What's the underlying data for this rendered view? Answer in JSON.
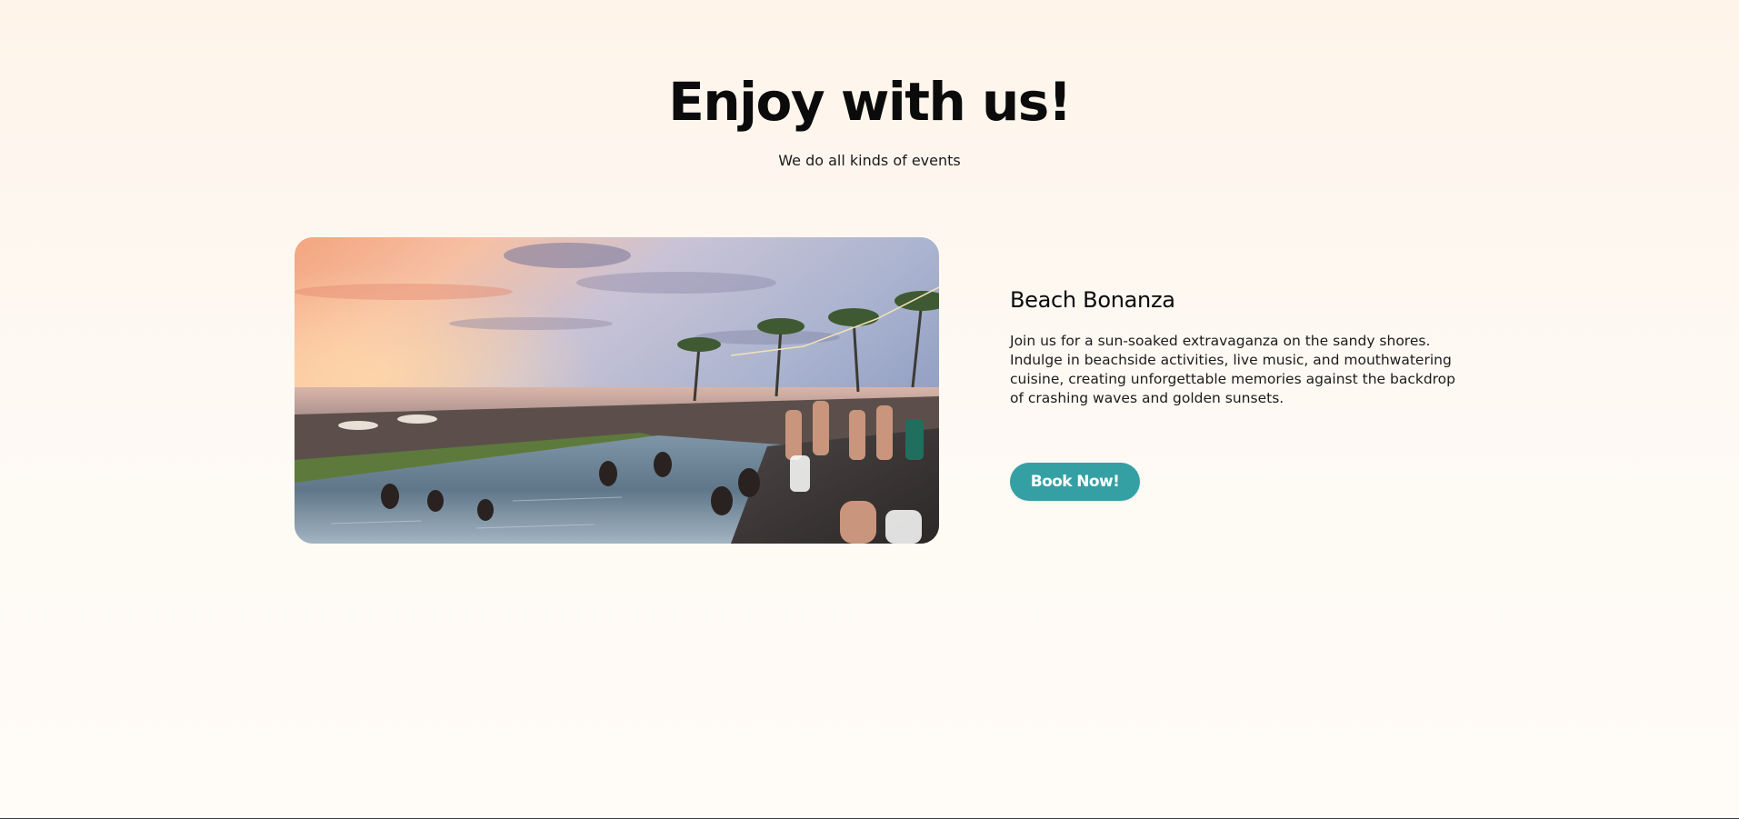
{
  "section": {
    "heading": "Enjoy with us!",
    "subheading": "We do all kinds of events"
  },
  "event": {
    "image_alt": "Beach party at a poolside with people swimming at sunset",
    "title": "Beach Bonanza",
    "description": "Join us for a sun-soaked extravaganza on the sandy shores. Indulge in beachside activities, live music, and mouthwatering cuisine, creating unforgettable memories against the backdrop of crashing waves and golden sunsets.",
    "button_label": "Book Now!"
  },
  "colors": {
    "background": "#fef6ee",
    "accent": "#34a0a4",
    "text": "#0b0b0b"
  }
}
